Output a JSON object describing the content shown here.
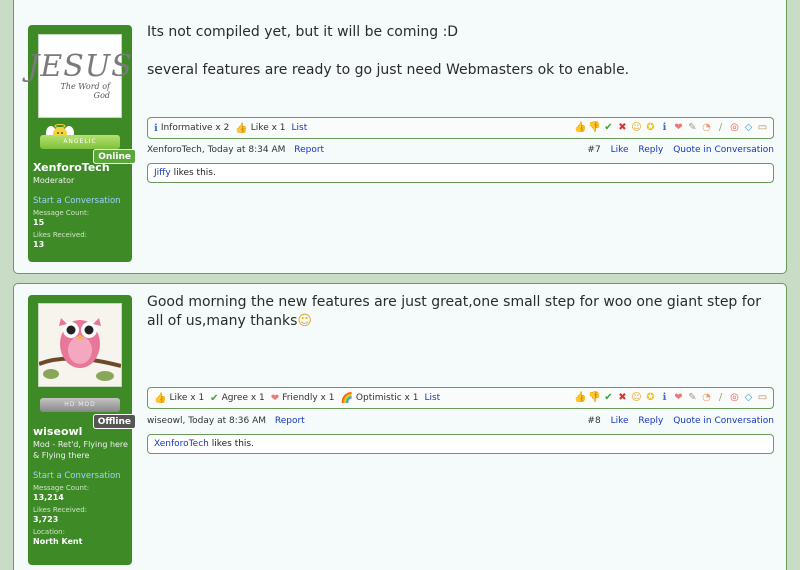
{
  "posts": [
    {
      "username": "XenforoTech",
      "user_title": "Moderator",
      "status": "Online",
      "rank_badge": "ANGELIC",
      "avatar_text": "JESUS",
      "avatar_subtext": "The Word of God",
      "start_conversation": "Start a Conversation",
      "stats": [
        {
          "label": "Message Count:",
          "value": "15"
        },
        {
          "label": "Likes Received:",
          "value": "13"
        }
      ],
      "message_lines": [
        "Its not compiled yet, but it will be coming :D",
        "several features are ready to go just need Webmasters ok to enable."
      ],
      "ratings": [
        {
          "icon": "ℹ",
          "label": "Informative x 2"
        },
        {
          "icon": "👍",
          "label": "Like x 1"
        }
      ],
      "list_label": "List",
      "author": "XenforoTech",
      "time": "Today at 8:34 AM",
      "report": "Report",
      "post_number": "#7",
      "like": "Like",
      "reply": "Reply",
      "quote": "Quote in Conversation",
      "liker": "Jiffy",
      "likes_text": "likes this."
    },
    {
      "username": "wiseowl",
      "user_title": "Mod - Ret'd, Flying here & Flying there",
      "status": "Offline",
      "rank_badge": "HD MOD",
      "start_conversation": "Start a Conversation",
      "stats": [
        {
          "label": "Message Count:",
          "value": "13,214"
        },
        {
          "label": "Likes Received:",
          "value": "3,723"
        },
        {
          "label": "Location:",
          "value": "North Kent"
        }
      ],
      "message_lines": [
        "Good morning the new features are just great,one small step for woo one giant step for",
        "all of us,many thanks"
      ],
      "ratings": [
        {
          "icon": "👍",
          "label": "Like x 1"
        },
        {
          "icon": "✔",
          "label": "Agree x 1"
        },
        {
          "icon": "❤",
          "label": "Friendly x 1"
        },
        {
          "icon": "🌈",
          "label": "Optimistic x 1"
        }
      ],
      "list_label": "List",
      "author": "wiseowl",
      "time": "Today at 8:36 AM",
      "report": "Report",
      "post_number": "#8",
      "like": "Like",
      "reply": "Reply",
      "quote": "Quote in Conversation",
      "liker": "XenforoTech",
      "likes_text": "likes this."
    }
  ],
  "rate_icons": [
    "thumbs-up-icon",
    "thumbs-down-icon",
    "check-icon",
    "x-icon",
    "smile-icon",
    "award-icon",
    "info-icon",
    "heart-icon",
    "wrench-icon",
    "rainbow-icon",
    "brush-icon",
    "lifebuoy-icon",
    "diamond-icon",
    "box-icon"
  ],
  "colors": {
    "sidebar": "#3e8a27",
    "link": "#1a37b8",
    "border": "#6a9a5c"
  }
}
